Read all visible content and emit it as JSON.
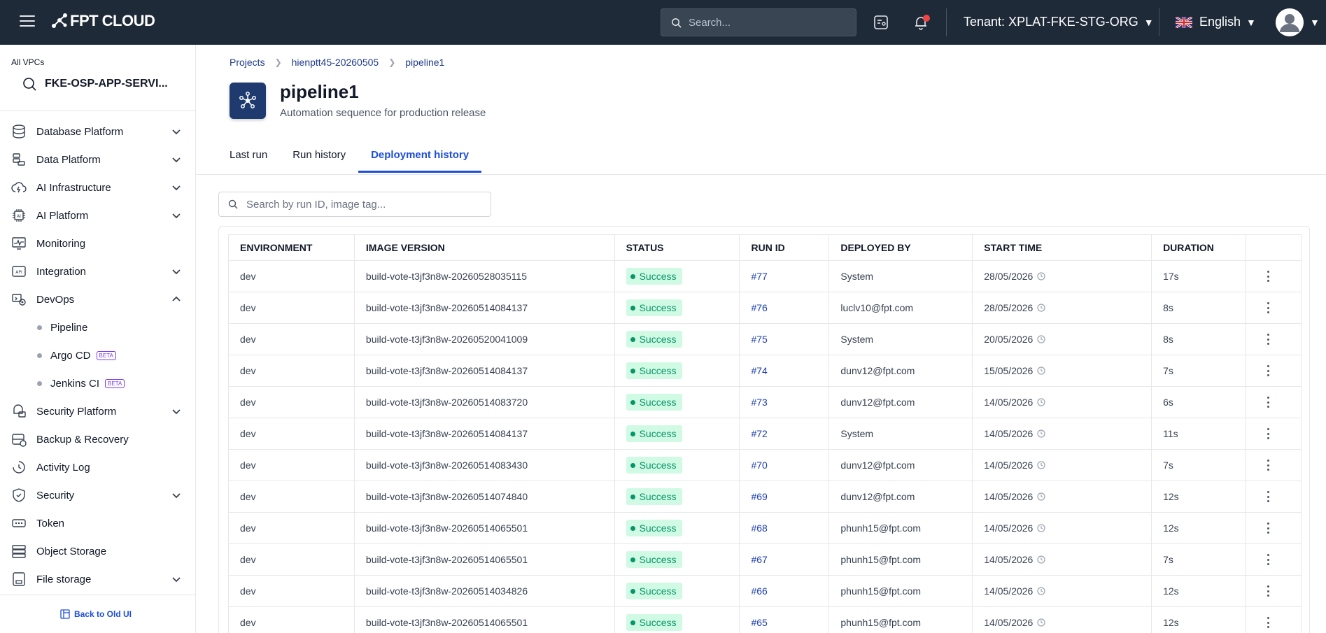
{
  "topbar": {
    "logo_text": "FPT CLOUD",
    "search_placeholder": "Search...",
    "tenant_label": "Tenant:",
    "tenant_value": "XPLAT-FKE-STG-ORG",
    "language": "English"
  },
  "sidebar": {
    "vpc_label": "All VPCs",
    "vpc_value": "FKE-OSP-APP-SERVI...",
    "items": [
      {
        "label": "Database Platform",
        "icon": "database-icon",
        "expandable": true
      },
      {
        "label": "Data Platform",
        "icon": "data-platform-icon",
        "expandable": true
      },
      {
        "label": "AI Infrastructure",
        "icon": "ai-infrastructure-icon",
        "expandable": true
      },
      {
        "label": "AI Platform",
        "icon": "ai-chip-icon",
        "expandable": true
      },
      {
        "label": "Monitoring",
        "icon": "monitoring-icon",
        "expandable": false
      },
      {
        "label": "Integration",
        "icon": "api-icon",
        "expandable": true
      },
      {
        "label": "DevOps",
        "icon": "devops-icon",
        "expandable": true,
        "expanded": true
      }
    ],
    "devops_sub": [
      {
        "label": "Pipeline",
        "beta": ""
      },
      {
        "label": "Argo CD",
        "beta": "BETA"
      },
      {
        "label": "Jenkins CI",
        "beta": "BETA"
      }
    ],
    "items_after": [
      {
        "label": "Security Platform",
        "icon": "security-platform-icon",
        "expandable": true
      },
      {
        "label": "Backup & Recovery",
        "icon": "backup-icon",
        "expandable": false
      },
      {
        "label": "Activity Log",
        "icon": "activity-log-icon",
        "expandable": false
      },
      {
        "label": "Security",
        "icon": "shield-icon",
        "expandable": true
      },
      {
        "label": "Token",
        "icon": "token-icon",
        "expandable": false
      },
      {
        "label": "Object Storage",
        "icon": "object-storage-icon",
        "expandable": false
      },
      {
        "label": "File storage",
        "icon": "file-storage-icon",
        "expandable": true
      }
    ],
    "back_old_ui": "Back to Old UI"
  },
  "breadcrumb": [
    "Projects",
    "hienptt45-20260505",
    "pipeline1"
  ],
  "page": {
    "title": "pipeline1",
    "subtitle": "Automation sequence for production release"
  },
  "tabs": [
    {
      "label": "Last run",
      "active": false
    },
    {
      "label": "Run history",
      "active": false
    },
    {
      "label": "Deployment history",
      "active": true
    }
  ],
  "table": {
    "search_placeholder": "Search by run ID, image tag...",
    "columns": [
      "ENVIRONMENT",
      "IMAGE VERSION",
      "STATUS",
      "RUN ID",
      "DEPLOYED BY",
      "START TIME",
      "DURATION",
      ""
    ],
    "rows": [
      {
        "env": "dev",
        "image": "build-vote-t3jf3n8w-20260528035115",
        "status": "Success",
        "run_id": "#77",
        "by": "System",
        "start": "28/05/2026",
        "duration": "17s"
      },
      {
        "env": "dev",
        "image": "build-vote-t3jf3n8w-20260514084137",
        "status": "Success",
        "run_id": "#76",
        "by": "luclv10@fpt.com",
        "start": "28/05/2026",
        "duration": "8s"
      },
      {
        "env": "dev",
        "image": "build-vote-t3jf3n8w-20260520041009",
        "status": "Success",
        "run_id": "#75",
        "by": "System",
        "start": "20/05/2026",
        "duration": "8s"
      },
      {
        "env": "dev",
        "image": "build-vote-t3jf3n8w-20260514084137",
        "status": "Success",
        "run_id": "#74",
        "by": "dunv12@fpt.com",
        "start": "15/05/2026",
        "duration": "7s"
      },
      {
        "env": "dev",
        "image": "build-vote-t3jf3n8w-20260514083720",
        "status": "Success",
        "run_id": "#73",
        "by": "dunv12@fpt.com",
        "start": "14/05/2026",
        "duration": "6s"
      },
      {
        "env": "dev",
        "image": "build-vote-t3jf3n8w-20260514084137",
        "status": "Success",
        "run_id": "#72",
        "by": "System",
        "start": "14/05/2026",
        "duration": "11s"
      },
      {
        "env": "dev",
        "image": "build-vote-t3jf3n8w-20260514083430",
        "status": "Success",
        "run_id": "#70",
        "by": "dunv12@fpt.com",
        "start": "14/05/2026",
        "duration": "7s"
      },
      {
        "env": "dev",
        "image": "build-vote-t3jf3n8w-20260514074840",
        "status": "Success",
        "run_id": "#69",
        "by": "dunv12@fpt.com",
        "start": "14/05/2026",
        "duration": "12s"
      },
      {
        "env": "dev",
        "image": "build-vote-t3jf3n8w-20260514065501",
        "status": "Success",
        "run_id": "#68",
        "by": "phunh15@fpt.com",
        "start": "14/05/2026",
        "duration": "12s"
      },
      {
        "env": "dev",
        "image": "build-vote-t3jf3n8w-20260514065501",
        "status": "Success",
        "run_id": "#67",
        "by": "phunh15@fpt.com",
        "start": "14/05/2026",
        "duration": "7s"
      },
      {
        "env": "dev",
        "image": "build-vote-t3jf3n8w-20260514034826",
        "status": "Success",
        "run_id": "#66",
        "by": "phunh15@fpt.com",
        "start": "14/05/2026",
        "duration": "12s"
      },
      {
        "env": "dev",
        "image": "build-vote-t3jf3n8w-20260514065501",
        "status": "Success",
        "run_id": "#65",
        "by": "phunh15@fpt.com",
        "start": "14/05/2026",
        "duration": "12s"
      }
    ]
  },
  "colors": {
    "topbar_bg": "#1e2a38",
    "accent": "#1d4ed8",
    "success_bg": "#d1fae5",
    "success_fg": "#059669"
  }
}
